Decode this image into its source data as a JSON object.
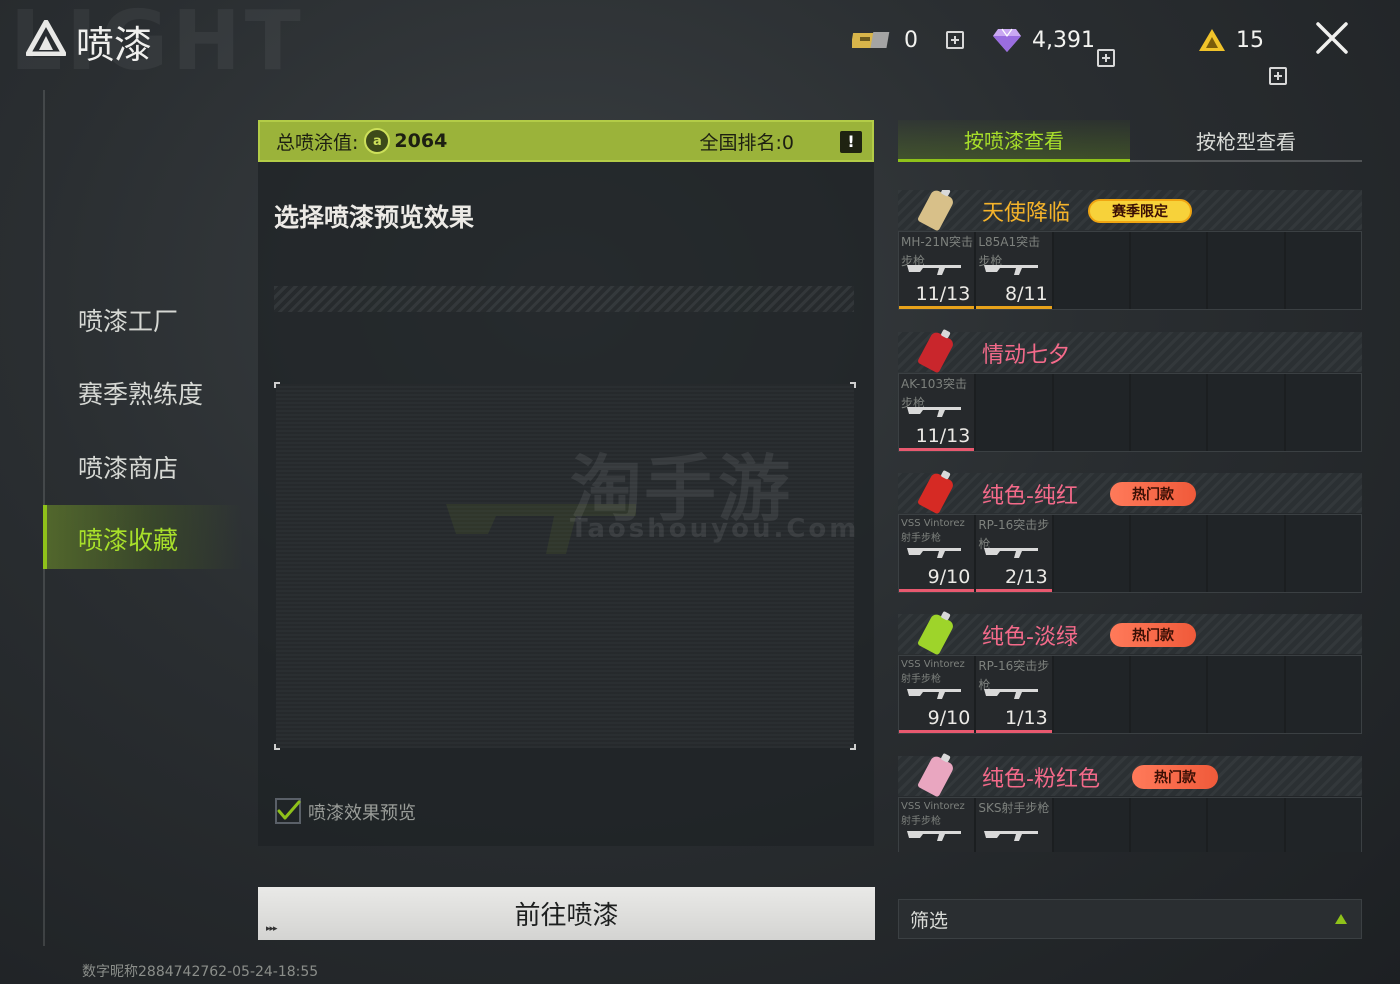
{
  "header": {
    "bg_word": "LIGHT",
    "title": "喷漆",
    "currencies": [
      {
        "name": "ticket-icon",
        "value": "0"
      },
      {
        "name": "diamond-icon",
        "value": "4,391"
      },
      {
        "name": "triangle-coin-icon",
        "value": "15"
      }
    ]
  },
  "nav": {
    "items": [
      "喷漆工厂",
      "赛季熟练度",
      "喷漆商店",
      "喷漆收藏"
    ],
    "active_index": 3
  },
  "score_bar": {
    "total_label": "总喷涂值:",
    "score": "2064",
    "rank_label": "全国排名:0",
    "warn": "!"
  },
  "preview": {
    "title": "选择喷漆预览效果",
    "watermark_cn": "淘手游",
    "watermark_en": "Taoshouyou.Com",
    "checkbox_label": "喷漆效果预览",
    "checkbox_checked": true
  },
  "go_button": {
    "label": "前往喷漆",
    "arrows": "▸▸▸"
  },
  "footer_id": "数字昵称2884742762-05-24-18:55",
  "tabs": [
    {
      "label": "按喷漆查看",
      "active": true
    },
    {
      "label": "按枪型查看",
      "active": false
    }
  ],
  "paint_groups": [
    {
      "name": "天使降临",
      "name_color": "#f5b32a",
      "can_color": "#d8c089",
      "badge": "赛季限定",
      "badge_type": "season",
      "underline": "#e8a21b",
      "weapons": [
        {
          "name": "MH-21N突击步枪",
          "count": "11/13"
        },
        {
          "name": "L85A1突击步枪",
          "count": "8/11"
        }
      ]
    },
    {
      "name": "情动七夕",
      "name_color": "#f46a8a",
      "can_color": "#c9262c",
      "badge": "",
      "badge_type": "",
      "underline": "#e8596f",
      "weapons": [
        {
          "name": "AK-103突击步枪",
          "count": "11/13"
        }
      ]
    },
    {
      "name": "纯色-纯红",
      "name_color": "#f46a8a",
      "can_color": "#d62a24",
      "badge": "热门款",
      "badge_type": "hot",
      "underline": "#e8596f",
      "weapons": [
        {
          "name": "VSS Vintorez射手步枪",
          "count": "9/10",
          "small": true
        },
        {
          "name": "RP-16突击步枪",
          "count": "2/13"
        }
      ]
    },
    {
      "name": "纯色-淡绿",
      "name_color": "#f46a8a",
      "can_color": "#9ed42a",
      "badge": "热门款",
      "badge_type": "hot",
      "underline": "#e8596f",
      "weapons": [
        {
          "name": "VSS Vintorez射手步枪",
          "count": "9/10",
          "small": true
        },
        {
          "name": "RP-16突击步枪",
          "count": "1/13"
        }
      ]
    },
    {
      "name": "纯色-粉红色",
      "name_color": "#f46a8a",
      "can_color": "#e9a6c0",
      "badge": "热门款",
      "badge_type": "hot",
      "underline": "#e8596f",
      "weapons": [
        {
          "name": "VSS Vintorez射手步枪",
          "count": "",
          "small": true
        },
        {
          "name": "SKS射手步枪",
          "count": ""
        }
      ]
    }
  ],
  "filter": {
    "label": "筛选"
  },
  "colors": {
    "accent": "#8fc21a",
    "accent_text": "#a8df2a"
  }
}
